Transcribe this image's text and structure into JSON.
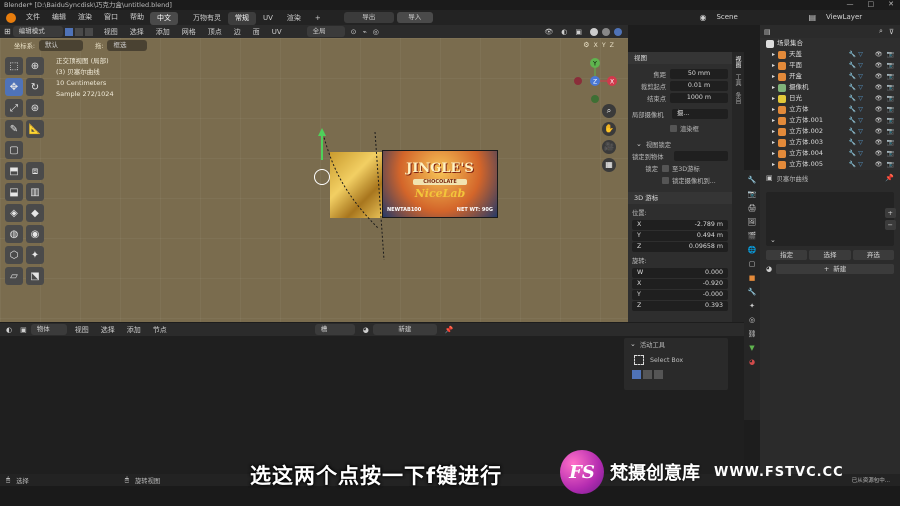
{
  "window": {
    "title": "Blender* [D:\\BaiduSyncdisk\\巧克力盒\\untitled.blend]",
    "controls": [
      "—",
      "□",
      "✕"
    ]
  },
  "menubar": {
    "items": [
      "文件",
      "编辑",
      "渲染",
      "窗口",
      "帮助"
    ],
    "lang": "中文",
    "workspaces": [
      "万物有灵",
      "常规",
      "UV",
      "渲染"
    ],
    "active_workspace": "常规",
    "add_tab": "+",
    "export_label": "导出",
    "import_label": "导入",
    "scene": "Scene",
    "view_layer": "ViewLayer"
  },
  "viewport_header": {
    "mode": "编辑模式",
    "menus": [
      "视图",
      "选择",
      "添加",
      "网格",
      "顶点",
      "边",
      "面",
      "UV"
    ],
    "transform": "全局",
    "coord_label": "坐标系:",
    "coord_value": "默认",
    "drag_label": "拖:",
    "select_label": "框选",
    "axes": [
      "X",
      "Y",
      "Z"
    ]
  },
  "viewport_overlay": {
    "view_name": "正交顶视图 (局部)",
    "object": "(3) 贝塞尔曲线",
    "scale": "10 Centimeters",
    "sample": "Sample 272/1024"
  },
  "chocolate_label": {
    "brand": "JINGLE'S",
    "sub": "CHOCOLATE",
    "tag": "NiceLab",
    "left": "NEWTAB100",
    "right": "NET WT: 90G"
  },
  "gizmo": {
    "x": "X",
    "y": "Y",
    "z": "Z"
  },
  "n_panel": {
    "tabs": [
      "视图",
      "工具",
      "条目"
    ],
    "view_section": "视图",
    "focal_label": "焦距",
    "focal_value": "50 mm",
    "clip_start_label": "裁剪起点",
    "clip_start_value": "0.01 m",
    "clip_end_label": "结束点",
    "clip_end_value": "1000 m",
    "local_camera_label": "局部摄像机",
    "local_camera_value": "摄...",
    "render_region_label": "渲染框",
    "view_lock_section": "视图锁定",
    "lock_object_label": "锁定到物体",
    "lock_label": "锁定",
    "lock_3d_cursor": "至3D游标",
    "lock_camera": "锁定摄像机到...",
    "cursor_section": "3D 游标",
    "location_label": "位置:",
    "loc_x_label": "X",
    "loc_x_value": "-2.789 m",
    "loc_y_label": "Y",
    "loc_y_value": "0.494 m",
    "loc_z_label": "Z",
    "loc_z_value": "0.09658 m",
    "rotation_label": "旋转:",
    "rot_w_label": "W",
    "rot_w_value": "0.000",
    "rot_x_label": "X",
    "rot_x_value": "-0.920",
    "rot_y_label": "Y",
    "rot_y_value": "-0.000",
    "rot_z_label": "Z",
    "rot_z_value": "0.393"
  },
  "lower_editor": {
    "mode": "物体",
    "menus": [
      "视图",
      "选择",
      "添加",
      "节点"
    ],
    "slot": "槽",
    "new_label": "新建",
    "tool_panel_title": "活动工具",
    "tool_name": "Select Box"
  },
  "outliner": {
    "root": "场景集合",
    "items": [
      {
        "name": "天盖",
        "color": "#e38a3a"
      },
      {
        "name": "平面",
        "color": "#e38a3a"
      },
      {
        "name": "开盒",
        "color": "#e38a3a"
      },
      {
        "name": "摄像机",
        "color": "#7fb37a"
      },
      {
        "name": "日光",
        "color": "#e3c93a"
      },
      {
        "name": "立方体",
        "color": "#e38a3a"
      },
      {
        "name": "立方体.001",
        "color": "#e38a3a"
      },
      {
        "name": "立方体.002",
        "color": "#e38a3a"
      },
      {
        "name": "立方体.003",
        "color": "#e38a3a"
      },
      {
        "name": "立方体.004",
        "color": "#e38a3a"
      },
      {
        "name": "立方体.005",
        "color": "#e38a3a"
      }
    ]
  },
  "material_panel": {
    "object": "贝塞尔曲线",
    "assign": "指定",
    "select": "选择",
    "deselect": "弃选",
    "new": "新建",
    "plus": "+",
    "minus": "−"
  },
  "statusbar": {
    "left_action": "选择",
    "mid_action": "旋转视图",
    "right_text": "已从资源包中..."
  },
  "subtitle": "选这两个点按一下f键进行",
  "watermark": {
    "logo": "FS",
    "name": "梵摄创意库",
    "url": "WWW.FSTVC.CC"
  },
  "colors": {
    "accent": "#4f73b8",
    "viewport_bg": "#7a6c4e",
    "panel": "#2e2e2e"
  }
}
